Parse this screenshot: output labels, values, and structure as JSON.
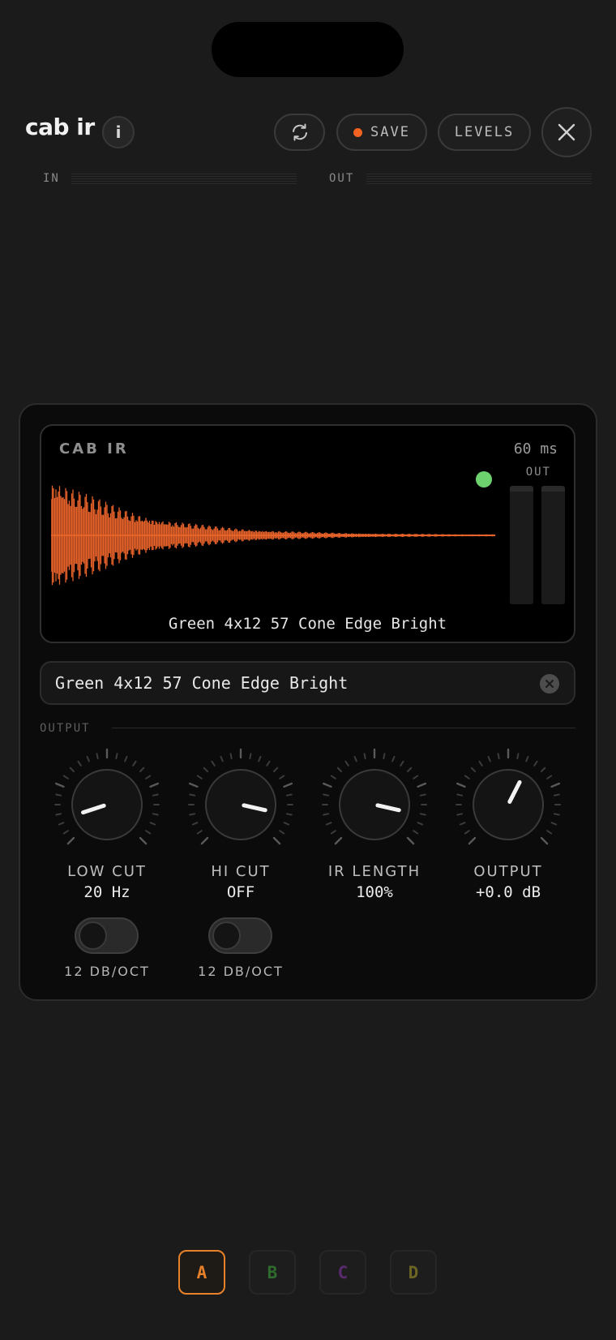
{
  "header": {
    "title": "cab ir",
    "info_glyph": "i",
    "save_label": "SAVE",
    "levels_label": "LEVELS",
    "save_dot_color": "#f26322"
  },
  "meters": {
    "in_label": "IN",
    "out_label": "OUT"
  },
  "scope": {
    "title": "CAB IR",
    "length": "60 ms",
    "out_label": "OUT",
    "ir_name": "Green 4x12 57 Cone Edge Bright",
    "wave_color": "#e8632a",
    "led_color": "#6dd16e"
  },
  "ir_field": {
    "value": "Green 4x12 57 Cone Edge Bright"
  },
  "section": {
    "label": "OUTPUT"
  },
  "knobs": [
    {
      "label": "LOW CUT",
      "value": "20 Hz",
      "level": 0.1
    },
    {
      "label": "HI CUT",
      "value": "OFF",
      "level": 0.88
    },
    {
      "label": "IR LENGTH",
      "value": "100%",
      "level": 0.88
    },
    {
      "label": "OUTPUT",
      "value": "+0.0 dB",
      "level": 0.6
    }
  ],
  "toggles": [
    {
      "label": "12 DB/OCT",
      "on": false
    },
    {
      "label": "12 DB/OCT",
      "on": false
    }
  ],
  "slots": [
    {
      "label": "A",
      "color": "#e8822a",
      "active": true
    },
    {
      "label": "B",
      "color": "#2f6b2f",
      "active": false
    },
    {
      "label": "C",
      "color": "#5a2a6e",
      "active": false
    },
    {
      "label": "D",
      "color": "#6b6422",
      "active": false
    }
  ]
}
